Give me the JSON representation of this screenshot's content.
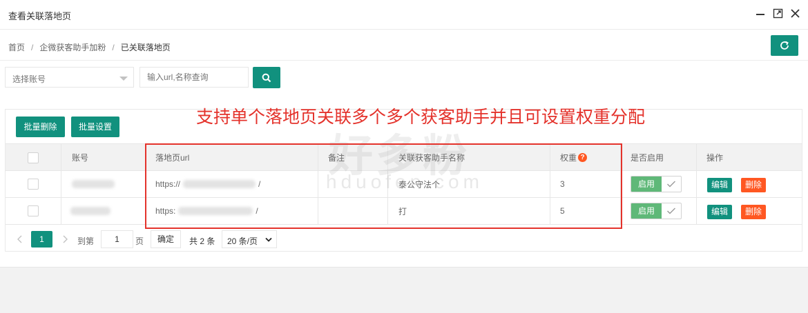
{
  "window": {
    "title": "查看关联落地页"
  },
  "breadcrumb": {
    "items": [
      "首页",
      "企微获客助手加粉",
      "已关联落地页"
    ],
    "separator": "/"
  },
  "filters": {
    "account_placeholder": "选择账号",
    "search_placeholder": "输入url,名称查询"
  },
  "toolbar": {
    "batch_delete_label": "批量删除",
    "batch_settings_label": "批量设置"
  },
  "annotation": "支持单个落地页关联多个多个获客助手并且可设置权重分配",
  "watermark": {
    "main": "好多粉",
    "sub": "hduofen.com"
  },
  "table": {
    "columns": {
      "account": "账号",
      "url": "落地页url",
      "remark": "备注",
      "assistant": "关联获客助手名称",
      "weight": "权重",
      "enabled": "是否启用",
      "actions": "操作"
    },
    "rows": [
      {
        "url_prefix": "https://",
        "url_suffix": "/",
        "remark": "",
        "assistant": "泰公守法个",
        "weight": "3",
        "enable_label": "启用",
        "edit_label": "编辑",
        "delete_label": "删除"
      },
      {
        "url_prefix": "https:",
        "url_suffix": "/",
        "remark": "",
        "assistant": "打",
        "weight": "5",
        "enable_label": "启用",
        "edit_label": "编辑",
        "delete_label": "删除"
      }
    ]
  },
  "pagination": {
    "current_page": "1",
    "goto_label": "到第",
    "page_input": "1",
    "page_unit": "页",
    "confirm_label": "确定",
    "total_text": "共 2 条",
    "page_size": "20 条/页"
  },
  "colors": {
    "primary": "#11917e",
    "danger": "#ff5722",
    "switch_on": "#5fb878",
    "annotation": "#e4322b"
  }
}
